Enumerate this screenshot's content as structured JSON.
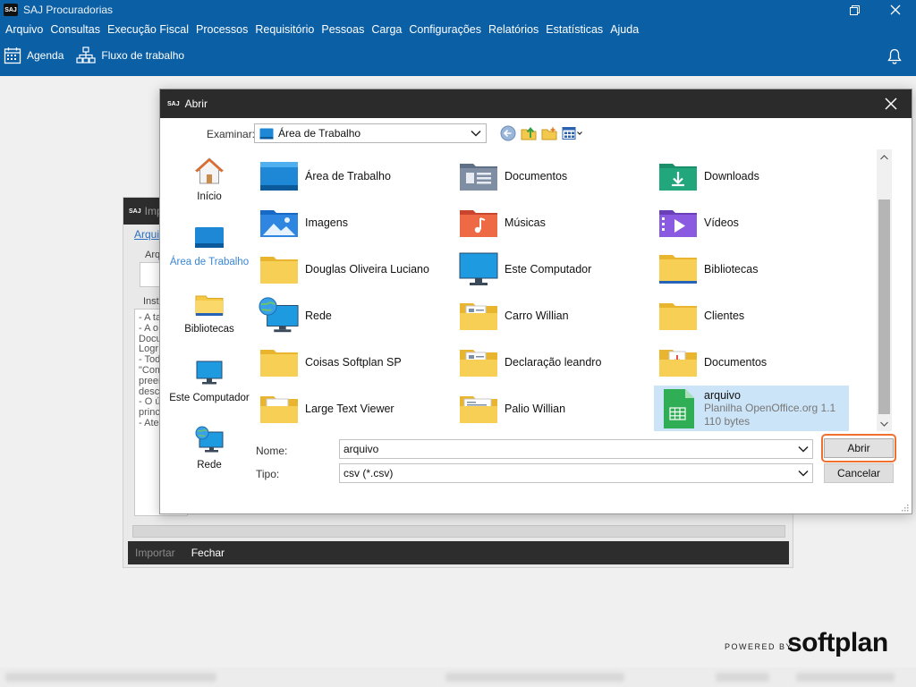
{
  "app": {
    "title": "SAJ Procuradorias",
    "logo_text": "SAJ",
    "menu": [
      "Arquivo",
      "Consultas",
      "Execução Fiscal",
      "Processos",
      "Requisitório",
      "Pessoas",
      "Carga",
      "Configurações",
      "Relatórios",
      "Estatísticas",
      "Ajuda"
    ],
    "toolbar": {
      "agenda": "Agenda",
      "workflow": "Fluxo de trabalho"
    }
  },
  "import_window": {
    "title": "Imp",
    "tab": "Arqui",
    "group_label": "Arq",
    "instructions_label": "Instr",
    "instructions": [
      "- A ta",
      "- A o",
      "Docu",
      "Logr",
      "- Tod",
      "\"Com",
      "preer",
      "desc",
      "- O ú",
      "princ",
      "- Ate"
    ],
    "buttons": {
      "import": "Importar",
      "close": "Fechar"
    }
  },
  "dialog": {
    "title": "Abrir",
    "look_in_label": "Examinar:",
    "look_in_value": "Área de Trabalho",
    "places": [
      {
        "label": "Início",
        "icon": "home-icon"
      },
      {
        "label": "Área de Trabalho",
        "icon": "desktop-icon"
      },
      {
        "label": "Bibliotecas",
        "icon": "libraries-icon"
      },
      {
        "label": "Este Computador",
        "icon": "computer-icon"
      },
      {
        "label": "Rede",
        "icon": "network-icon"
      }
    ],
    "files": [
      {
        "name": "Área de Trabalho",
        "icon": "desktop-folder-icon"
      },
      {
        "name": "Documentos",
        "icon": "documents-folder-icon"
      },
      {
        "name": "Downloads",
        "icon": "downloads-folder-icon"
      },
      {
        "name": "Imagens",
        "icon": "pictures-folder-icon"
      },
      {
        "name": "Músicas",
        "icon": "music-folder-icon"
      },
      {
        "name": "Vídeos",
        "icon": "videos-folder-icon"
      },
      {
        "name": "Douglas Oliveira Luciano",
        "icon": "folder-icon"
      },
      {
        "name": "Este Computador",
        "icon": "computer-icon"
      },
      {
        "name": "Bibliotecas",
        "icon": "libraries-folder-icon"
      },
      {
        "name": "Rede",
        "icon": "network-icon"
      },
      {
        "name": "Carro Willian",
        "icon": "folder-docs-icon"
      },
      {
        "name": "Clientes",
        "icon": "folder-icon"
      },
      {
        "name": "Coisas Softplan SP",
        "icon": "folder-icon"
      },
      {
        "name": "Declaração leandro",
        "icon": "folder-docs-icon"
      },
      {
        "name": "Documentos",
        "icon": "folder-pdf-icon"
      },
      {
        "name": "Large Text Viewer",
        "icon": "folder-docs-icon"
      },
      {
        "name": "Palio Willian",
        "icon": "folder-docs-icon"
      }
    ],
    "selected_file": {
      "name": "arquivo",
      "type": "Planilha OpenOffice.org 1.1",
      "size": "110 bytes",
      "icon": "spreadsheet-icon"
    },
    "name_label": "Nome:",
    "name_value": "arquivo",
    "type_label": "Tipo:",
    "type_value": "csv (*.csv)",
    "open_button": "Abrir",
    "cancel_button": "Cancelar"
  },
  "branding": {
    "powered_by": "POWERED BY",
    "brand": "softplan"
  },
  "colors": {
    "header_blue": "#0b5fa5",
    "dark_bar": "#2b2b2b",
    "highlight": "#f07030",
    "selection": "#cce4f7"
  }
}
